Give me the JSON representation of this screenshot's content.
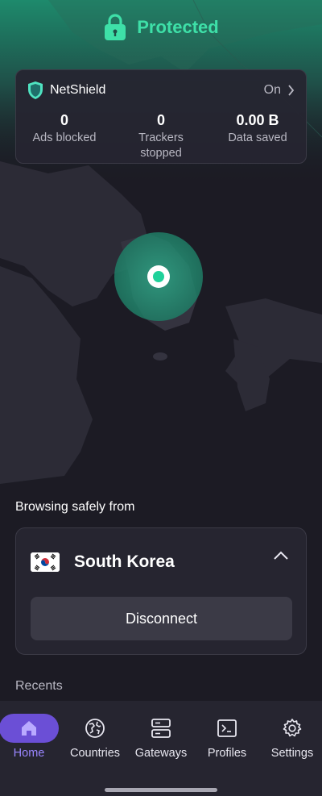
{
  "header": {
    "title": "Protected",
    "icon": "lock-icon"
  },
  "netshield": {
    "title": "NetShield",
    "state": "On",
    "stats": [
      {
        "value": "0",
        "label": "Ads blocked"
      },
      {
        "value": "0",
        "label": "Trackers stopped"
      },
      {
        "value": "0.00 B",
        "label": "Data saved"
      }
    ]
  },
  "connection": {
    "browsing_label": "Browsing safely from",
    "country": "South Korea",
    "disconnect_label": "Disconnect"
  },
  "recents": {
    "label": "Recents"
  },
  "nav": {
    "items": [
      {
        "label": "Home",
        "icon": "home-icon",
        "active": true
      },
      {
        "label": "Countries",
        "icon": "globe-icon"
      },
      {
        "label": "Gateways",
        "icon": "server-icon"
      },
      {
        "label": "Profiles",
        "icon": "terminal-icon"
      },
      {
        "label": "Settings",
        "icon": "gear-icon"
      }
    ]
  },
  "colors": {
    "accent": "#3ee0a8",
    "nav_active": "#6b4fd6",
    "background": "#1c1b24",
    "card": "#262530"
  }
}
